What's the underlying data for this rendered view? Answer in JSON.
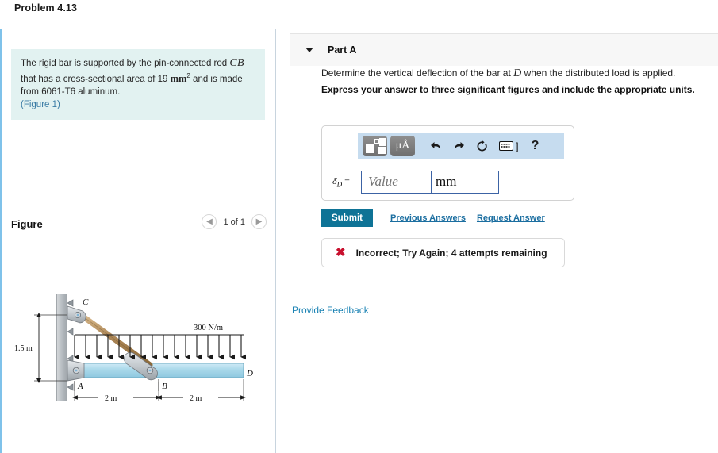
{
  "problem": {
    "title": "Problem 4.13",
    "statement_line1_a": "The rigid bar is supported by the pin-connected rod ",
    "statement_rod": "CB",
    "statement_line2_a": "that has a cross-sectional area of 19 ",
    "statement_units": "mm",
    "statement_units_sup": "2",
    "statement_line2_b": " and is made",
    "statement_line3": "from 6061-T6 aluminum.",
    "figure_link": "(Figure 1)"
  },
  "figure": {
    "title": "Figure",
    "prev_icon": "chevron-left-icon",
    "next_icon": "chevron-right-icon",
    "counter": "1 of 1",
    "labels": {
      "c": "C",
      "a": "A",
      "b": "B",
      "d": "D",
      "height": "1.5 m",
      "load": "300 N/m",
      "span_left": "2 m",
      "span_right": "2 m"
    },
    "colors": {
      "bar": "#a8d8ea",
      "rod": "#b08a5a",
      "wall": "#b9bec3"
    }
  },
  "part_a": {
    "caret_icon": "caret-down-icon",
    "label": "Part A",
    "question_a": "Determine the vertical deflection of the bar at ",
    "question_var": "D",
    "question_b": " when the distributed load is applied.",
    "instruction": "Express your answer to three significant figures and include the appropriate units."
  },
  "answer": {
    "toolbar": {
      "template_icon": "math-template-icon",
      "units_icon": "micro-angstrom-units-icon",
      "units_label": "μÅ",
      "undo_icon": "undo-arrow-icon",
      "undo_glyph": "⬅",
      "redo_icon": "redo-arrow-icon",
      "redo_glyph": "➡",
      "reset_icon": "reset-circular-arrow-icon",
      "reset_glyph": "↻",
      "keyboard_icon": "keyboard-icon",
      "keyboard_bracket": "]",
      "help_icon": "help-question-icon",
      "help_glyph": "?"
    },
    "symbol_delta": "δ",
    "symbol_sub": "D",
    "symbol_eq": " =",
    "value_placeholder": "Value",
    "value": "",
    "units_value": "mm"
  },
  "actions": {
    "submit_label": "Submit",
    "previous_answers_label": "Previous Answers",
    "request_answer_label": "Request Answer"
  },
  "feedback": {
    "icon": "x-mark-icon",
    "glyph": "✖",
    "message": "Incorrect; Try Again; 4 attempts remaining"
  },
  "footer": {
    "provide_feedback_label": "Provide Feedback"
  },
  "colors": {
    "accent_blue": "#0e7396",
    "link_blue": "#1b6ea0",
    "statement_bg": "#e2f2f1",
    "toolbar_bg": "#c6dcef",
    "error_red": "#c8102e",
    "left_border": "#7fc2ea"
  }
}
